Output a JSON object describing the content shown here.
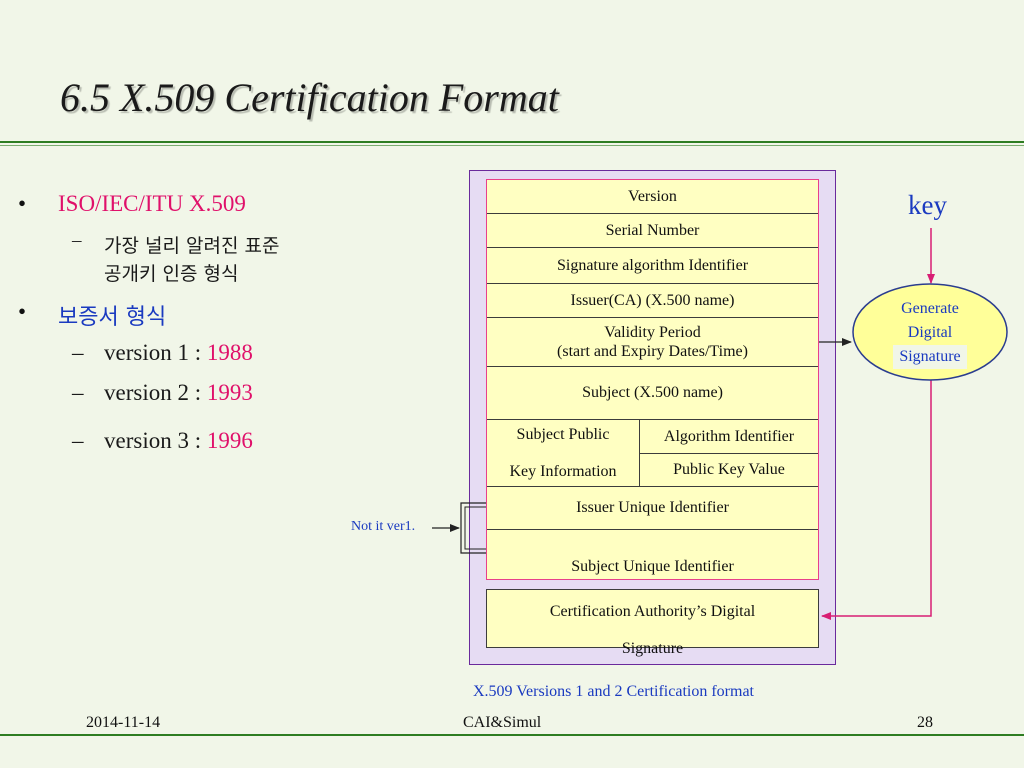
{
  "slide": {
    "title": "6.5 X.509 Certification Format",
    "left": {
      "b1": "ISO/IEC/ITU X.509",
      "b1_sub_line1": "가장 널리 알려진 표준",
      "b1_sub_line2": "공개키 인증 형식",
      "b2": "보증서 형식",
      "versions": [
        {
          "label": "version 1 :",
          "year": "1988"
        },
        {
          "label": "version 2 :",
          "year": "1993"
        },
        {
          "label": "version 3 :",
          "year": "1996"
        }
      ]
    },
    "diagram": {
      "rows": {
        "version": "Version",
        "serial": "Serial Number",
        "sig_alg": "Signature algorithm Identifier",
        "issuer": "Issuer(CA) (X.500 name)",
        "validity_l1": "Validity Period",
        "validity_l2": "(start and Expiry Dates/Time)",
        "subject": "Subject (X.500 name)",
        "spki_l1": "Subject Public",
        "spki_l2": "Key Information",
        "alg_id": "Algorithm Identifier",
        "pk_value": "Public Key Value",
        "issuer_uid": "Issuer Unique Identifier",
        "subject_uid": "Subject Unique Identifier",
        "ca_sig_l1": "Certification Authority’s Digital",
        "ca_sig_l2": "Signature"
      },
      "key": "key",
      "gen_l1": "Generate",
      "gen_l2": "Digital",
      "gen_l3": "Signature",
      "not_ver1": "Not  it ver1.",
      "caption": "X.509 Versions 1 and 2 Certification format"
    },
    "footer": {
      "date": "2014-11-14",
      "center": "CAI&Simul",
      "page": "28"
    },
    "colors": {
      "background": "#f1f6e8",
      "rule": "#2e7d22",
      "outer_box": "#6a2a9c",
      "inner_border": "#e8408a",
      "cell_fill": "#ffffc2",
      "arrow": "#d81e74",
      "ellipse_fill": "#ffff99",
      "blue_text": "#1a3ac0",
      "red_text": "#e0106a"
    }
  }
}
